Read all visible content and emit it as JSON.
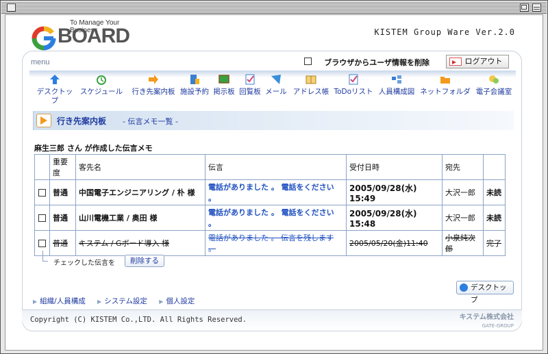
{
  "header": {
    "tagline": "To Manage Your Business",
    "logo_word": "BOARD",
    "logo_g": "G",
    "version": "KISTEM Group Ware Ver.2.0"
  },
  "menu": {
    "label": "menu",
    "clear_browser_info_label": "ブラウザからユーザ情報を削除",
    "logout_label": "ログアウト",
    "items": [
      {
        "label": "デスクトップ",
        "icon": "arrow-up-icon",
        "color": "#2d7fe0"
      },
      {
        "label": "スケジュール",
        "icon": "alarm-clock-icon",
        "color": "#3aa040"
      },
      {
        "label": "行き先案内板",
        "icon": "arrow-right-icon",
        "color": "#f39a1e"
      },
      {
        "label": "施設予約",
        "icon": "facility-icon",
        "color": "#3a7fd0"
      },
      {
        "label": "掲示板",
        "icon": "bulletin-board-icon",
        "color": "#3aa040"
      },
      {
        "label": "回覧板",
        "icon": "checklist-icon",
        "color": "#d04a7a"
      },
      {
        "label": "メール",
        "icon": "mail-icon",
        "color": "#3a8fd8"
      },
      {
        "label": "アドレス帳",
        "icon": "address-book-icon",
        "color": "#e0a030"
      },
      {
        "label": "ToDoリスト",
        "icon": "todo-icon",
        "color": "#d04a7a"
      },
      {
        "label": "人員構成図",
        "icon": "org-chart-icon",
        "color": "#3a7fd0"
      },
      {
        "label": "ネットフォルダ",
        "icon": "folder-icon",
        "color": "#f39a1e"
      },
      {
        "label": "電子会議室",
        "icon": "conference-icon",
        "color": "#e0b030"
      }
    ]
  },
  "section": {
    "title": "行き先案内板",
    "subtitle": "- 伝言メモ一覧 -"
  },
  "memo_owner": "麻生三郎 さん が作成した伝言メモ",
  "table": {
    "headers": [
      "",
      "重要度",
      "客先名",
      "伝言",
      "受付日時",
      "宛先",
      ""
    ],
    "rows": [
      {
        "importance": "普通",
        "customer": "中国電子エンジニアリング / 朴 様",
        "message": "電話がありました 。 電話をください 。",
        "date": "2005/09/28(水) 15:49",
        "to": "大沢一郎",
        "status": "未読",
        "done": false
      },
      {
        "importance": "普通",
        "customer": "山川電機工業 / 奥田 様",
        "message": "電話がありました 。 電話をください 。",
        "date": "2005/09/28(水) 15:48",
        "to": "大沢一郎",
        "status": "未読",
        "done": false
      },
      {
        "importance": "普通",
        "customer": "キステム / Gボード導入 様",
        "message": "電話がありました 。 伝言を残します 。",
        "date": "2005/05/20(金)11:40",
        "to": "小泉純次郎",
        "status": "完了",
        "done": true
      }
    ]
  },
  "actions": {
    "checked_label": "チェックした伝言を",
    "delete_label": "削除する",
    "desktop_label": "デスクトップ"
  },
  "footer_links": [
    "組織/人員構成",
    "システム設定",
    "個人設定"
  ],
  "footer": {
    "copyright": "Copyright (C) KISTEM Co.,LTD. All Rights Reserved.",
    "company": "キステム株式会社",
    "group": "GATE-GROUP"
  }
}
